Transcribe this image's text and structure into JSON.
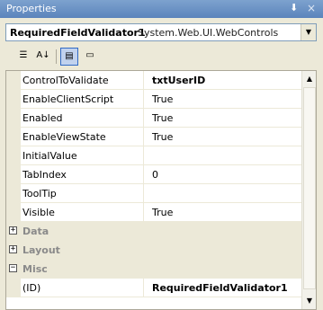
{
  "window": {
    "title": "Properties",
    "pin_glyph": "⬇",
    "close_glyph": "×"
  },
  "selector": {
    "object_name": "RequiredFieldValidator1",
    "object_type": "System.Web.UI.WebControls",
    "arrow_glyph": "▼"
  },
  "toolbar": {
    "categorized_glyph": "☰",
    "alphabetical_glyph": "A↓",
    "properties_glyph": "▤",
    "events_glyph": "▭"
  },
  "properties": [
    {
      "name": "ControlToValidate",
      "value": "txtUserID",
      "bold": true
    },
    {
      "name": "EnableClientScript",
      "value": "True"
    },
    {
      "name": "Enabled",
      "value": "True"
    },
    {
      "name": "EnableViewState",
      "value": "True"
    },
    {
      "name": "InitialValue",
      "value": ""
    },
    {
      "name": "TabIndex",
      "value": "0"
    },
    {
      "name": "ToolTip",
      "value": ""
    },
    {
      "name": "Visible",
      "value": "True"
    }
  ],
  "categories": [
    {
      "name": "Data",
      "expander": "+"
    },
    {
      "name": "Layout",
      "expander": "+"
    },
    {
      "name": "Misc",
      "expander": "−"
    }
  ],
  "misc_properties": [
    {
      "name": "(ID)",
      "value": "RequiredFieldValidator1",
      "bold": true
    }
  ],
  "scrollbar": {
    "up_glyph": "▲",
    "down_glyph": "▼"
  }
}
